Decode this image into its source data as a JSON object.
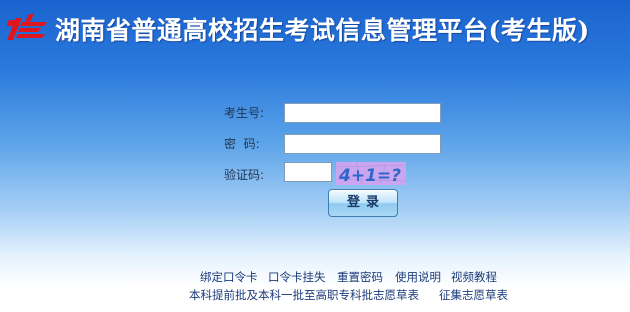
{
  "header": {
    "title": "湖南省普通高校招生考试信息管理平台(考生版)",
    "logo_icon": "hunan-exam-logo-icon"
  },
  "login_form": {
    "candidate_number_label": "考生号:",
    "candidate_number_value": "",
    "password_label": "密  码:",
    "password_value": "",
    "verification_code_label": "验证码:",
    "verification_code_value": "",
    "captcha_text": "4+1=?",
    "login_button_label": "登录"
  },
  "footer_links": {
    "row1": [
      "绑定口令卡",
      "口令卡挂失",
      "重置密码",
      "使用说明",
      "视频教程"
    ],
    "row2": [
      "本科提前批及本科一批至高职专科批志愿草表",
      "征集志愿草表"
    ]
  },
  "colors": {
    "title_text": "#ffffff",
    "logo_red": "#e0161e",
    "captcha_background": "#c9a6ef",
    "link_text": "#1d3b7a",
    "background_top": "#1a63cf",
    "background_bottom": "#ffffff"
  }
}
